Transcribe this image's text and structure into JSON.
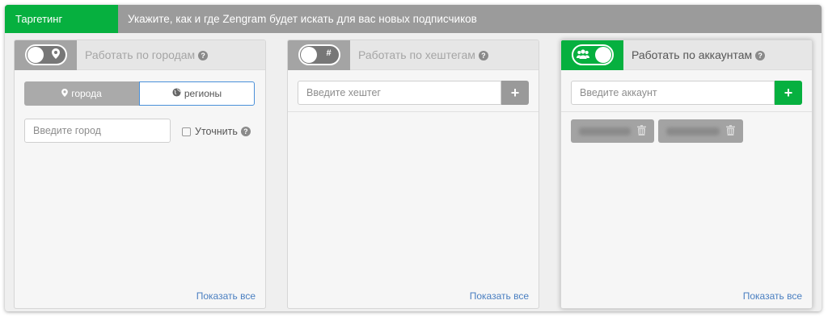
{
  "topbar": {
    "tab_label": "Таргетинг",
    "description": "Укажите, как и где Zengram будет искать для вас новых подписчиков"
  },
  "panels": {
    "cities": {
      "title": "Работать по городам",
      "toggle_state": "off",
      "toggle_icon": "map-marker-icon",
      "seg_cities": "города",
      "seg_regions": "регионы",
      "input_placeholder": "Введите город",
      "refine_label": "Уточнить",
      "refine_checked": false,
      "show_all": "Показать все"
    },
    "hashtags": {
      "title": "Работать по хештегам",
      "toggle_state": "off",
      "toggle_icon": "hashtag-icon",
      "input_placeholder": "Введите хештег",
      "show_all": "Показать все"
    },
    "accounts": {
      "title": "Работать по аккаунтам",
      "toggle_state": "on",
      "toggle_icon": "users-icon",
      "input_placeholder": "Введите аккаунт",
      "chips": [
        "",
        ""
      ],
      "show_all": "Показать все"
    }
  },
  "colors": {
    "accent_green": "#06b03f",
    "topbar_gray": "#9b9b9b",
    "link_blue": "#4a7fc1"
  }
}
